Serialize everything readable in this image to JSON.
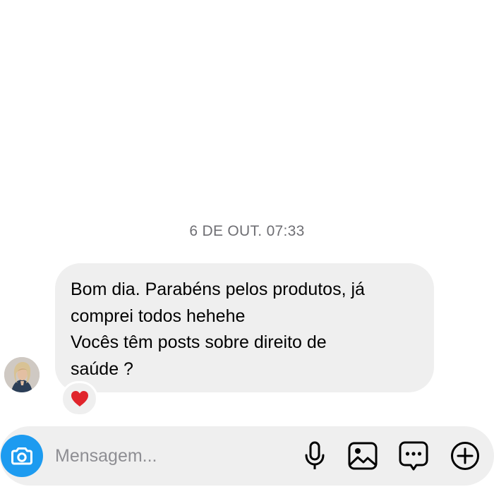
{
  "conversation": {
    "timestamp": "6 DE OUT. 07:33",
    "message": {
      "lines": [
        "Bom dia. Parabéns pelos produtos, já",
        "comprei todos hehehe",
        "Vocês têm posts sobre direito de",
        "saúde ?"
      ],
      "reaction": "heart"
    }
  },
  "composer": {
    "placeholder": "Mensagem...",
    "value": ""
  },
  "colors": {
    "accent": "#1d9bf0",
    "bubble": "#efefef",
    "timestamp_text": "#6e6e73",
    "placeholder_text": "#8e8e93",
    "reaction_heart": "#e0242b"
  },
  "icons": {
    "camera": "camera-icon",
    "microphone": "microphone-icon",
    "photo": "photo-icon",
    "sticker": "sticker-icon",
    "plus": "plus-icon",
    "reaction": "heart-icon"
  }
}
